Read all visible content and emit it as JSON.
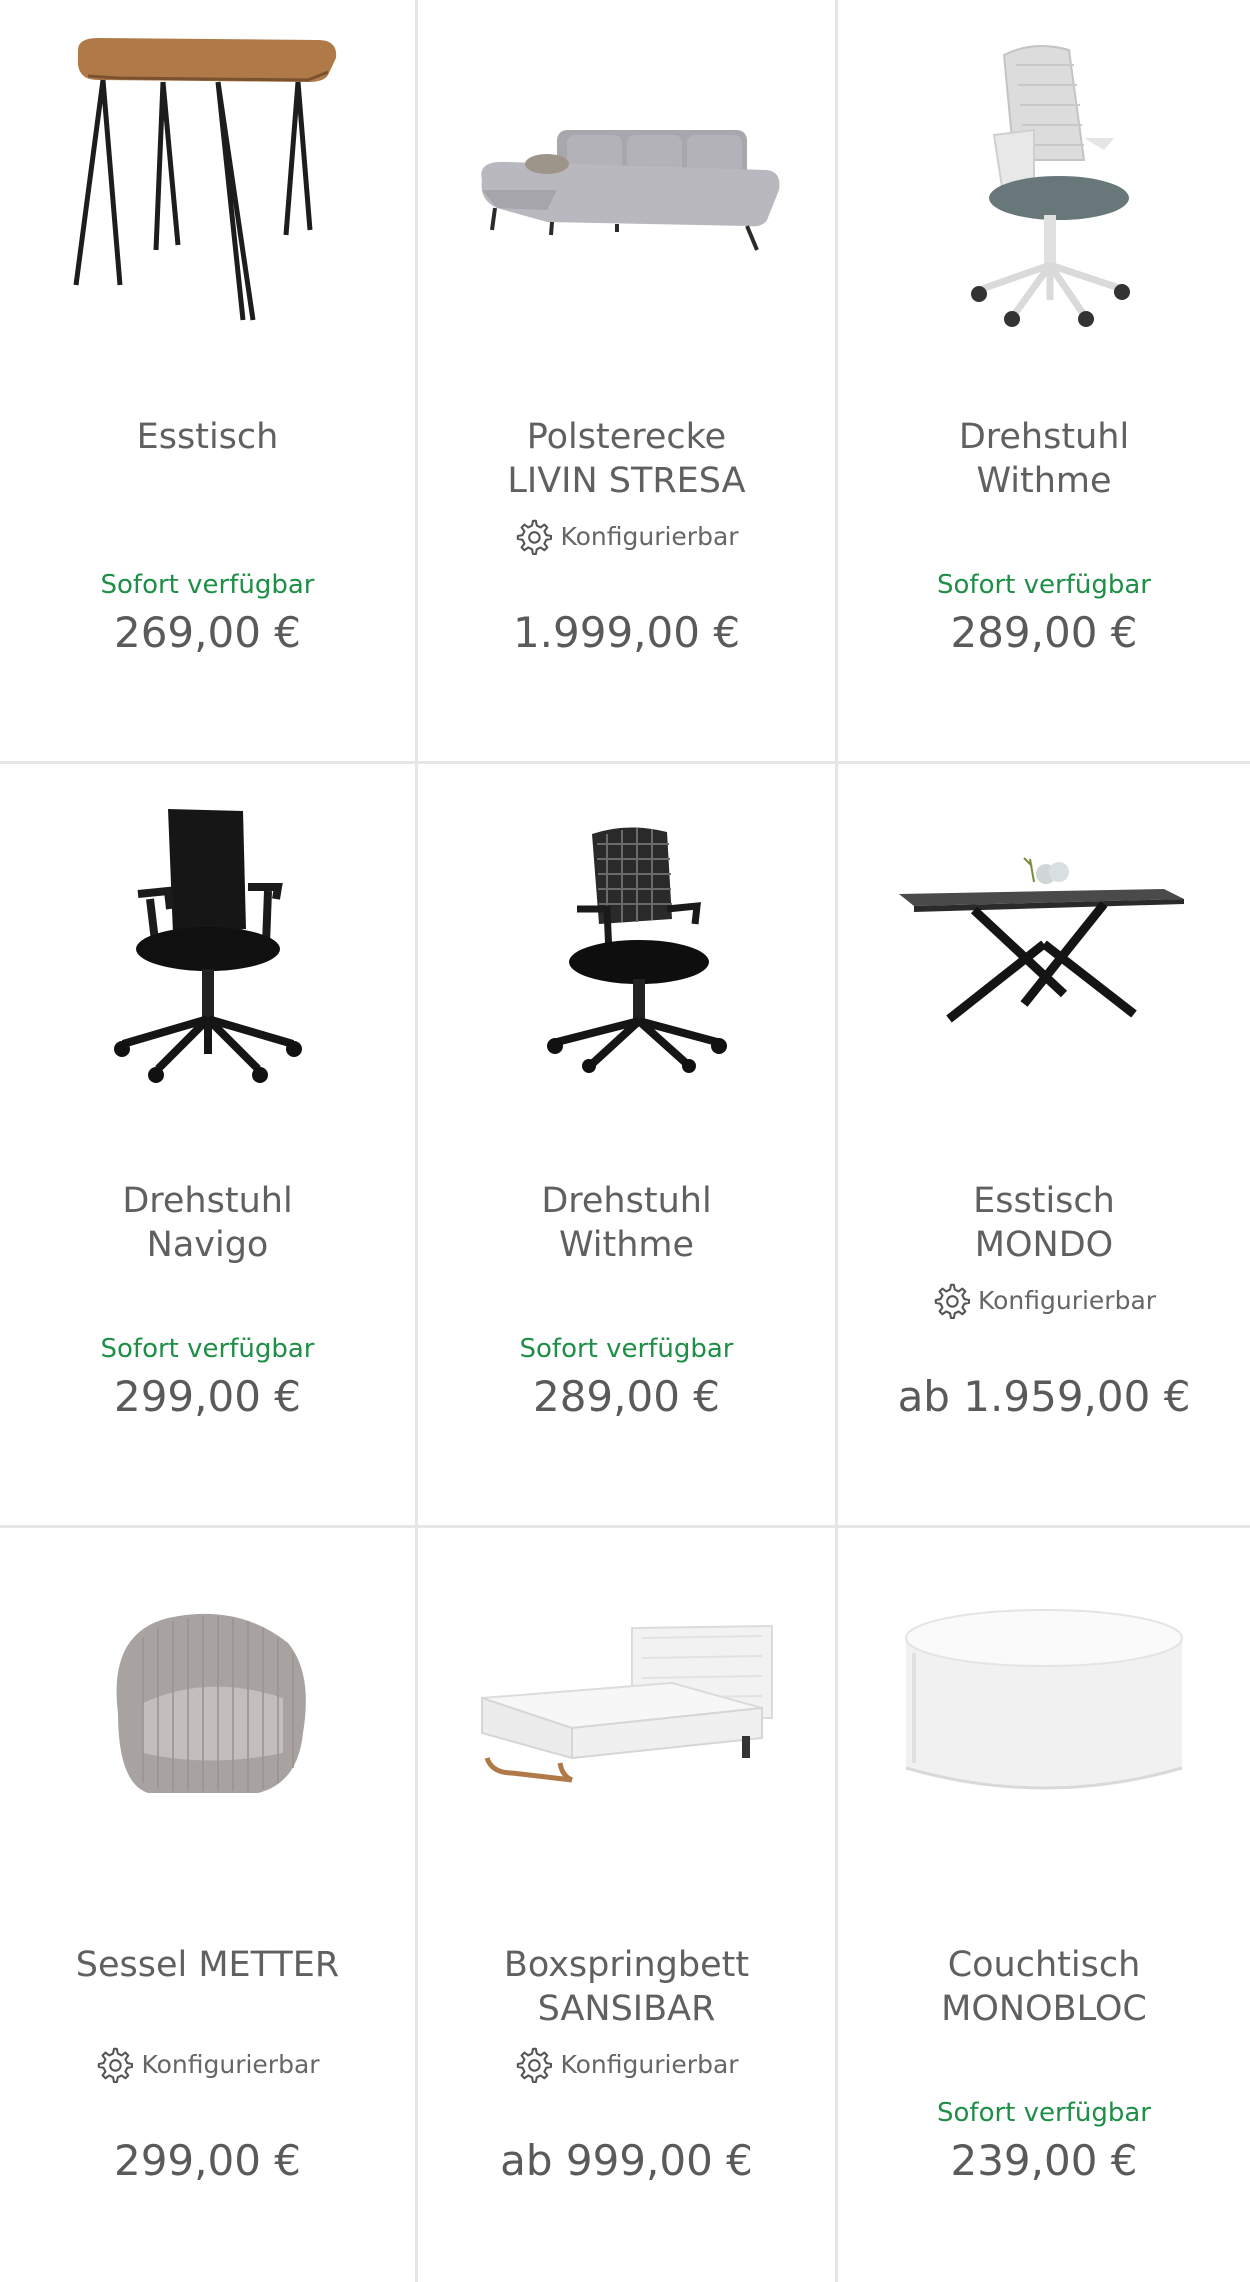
{
  "products": [
    {
      "name_line1": "Esstisch",
      "name_line2": "",
      "configurable_label": "",
      "availability": "Sofort verfügbar",
      "price": "269,00 €",
      "image_icon": "dining-table-wood-icon"
    },
    {
      "name_line1": "Polsterecke",
      "name_line2": "LIVIN STRESA",
      "configurable_label": "Konfigurierbar",
      "availability": "",
      "price": "1.999,00 €",
      "image_icon": "corner-sofa-icon"
    },
    {
      "name_line1": "Drehstuhl",
      "name_line2": "Withme",
      "configurable_label": "",
      "availability": "Sofort verfügbar",
      "price": "289,00 €",
      "image_icon": "office-chair-white-icon"
    },
    {
      "name_line1": "Drehstuhl",
      "name_line2": "Navigo",
      "configurable_label": "",
      "availability": "Sofort verfügbar",
      "price": "299,00 €",
      "image_icon": "office-chair-black-icon"
    },
    {
      "name_line1": "Drehstuhl",
      "name_line2": "Withme",
      "configurable_label": "",
      "availability": "Sofort verfügbar",
      "price": "289,00 €",
      "image_icon": "office-chair-mesh-icon"
    },
    {
      "name_line1": "Esstisch",
      "name_line2": "MONDO",
      "configurable_label": "Konfigurierbar",
      "availability": "",
      "price": "ab 1.959,00 €",
      "image_icon": "dining-table-black-icon"
    },
    {
      "name_line1": "Sessel METTER",
      "name_line2": "",
      "configurable_label": "Konfigurierbar",
      "availability": "",
      "price": "299,00 €",
      "image_icon": "armchair-icon"
    },
    {
      "name_line1": "Boxspringbett",
      "name_line2": "SANSIBAR",
      "configurable_label": "Konfigurierbar",
      "availability": "",
      "price": "ab 999,00 €",
      "image_icon": "boxspring-bed-icon"
    },
    {
      "name_line1": "Couchtisch",
      "name_line2": "MONOBLOC",
      "configurable_label": "",
      "availability": "Sofort verfügbar",
      "price": "239,00 €",
      "image_icon": "coffee-table-round-icon"
    }
  ],
  "colors": {
    "availability_green": "#1f8f47",
    "divider": "#e6e6e6",
    "text": "#606060"
  }
}
